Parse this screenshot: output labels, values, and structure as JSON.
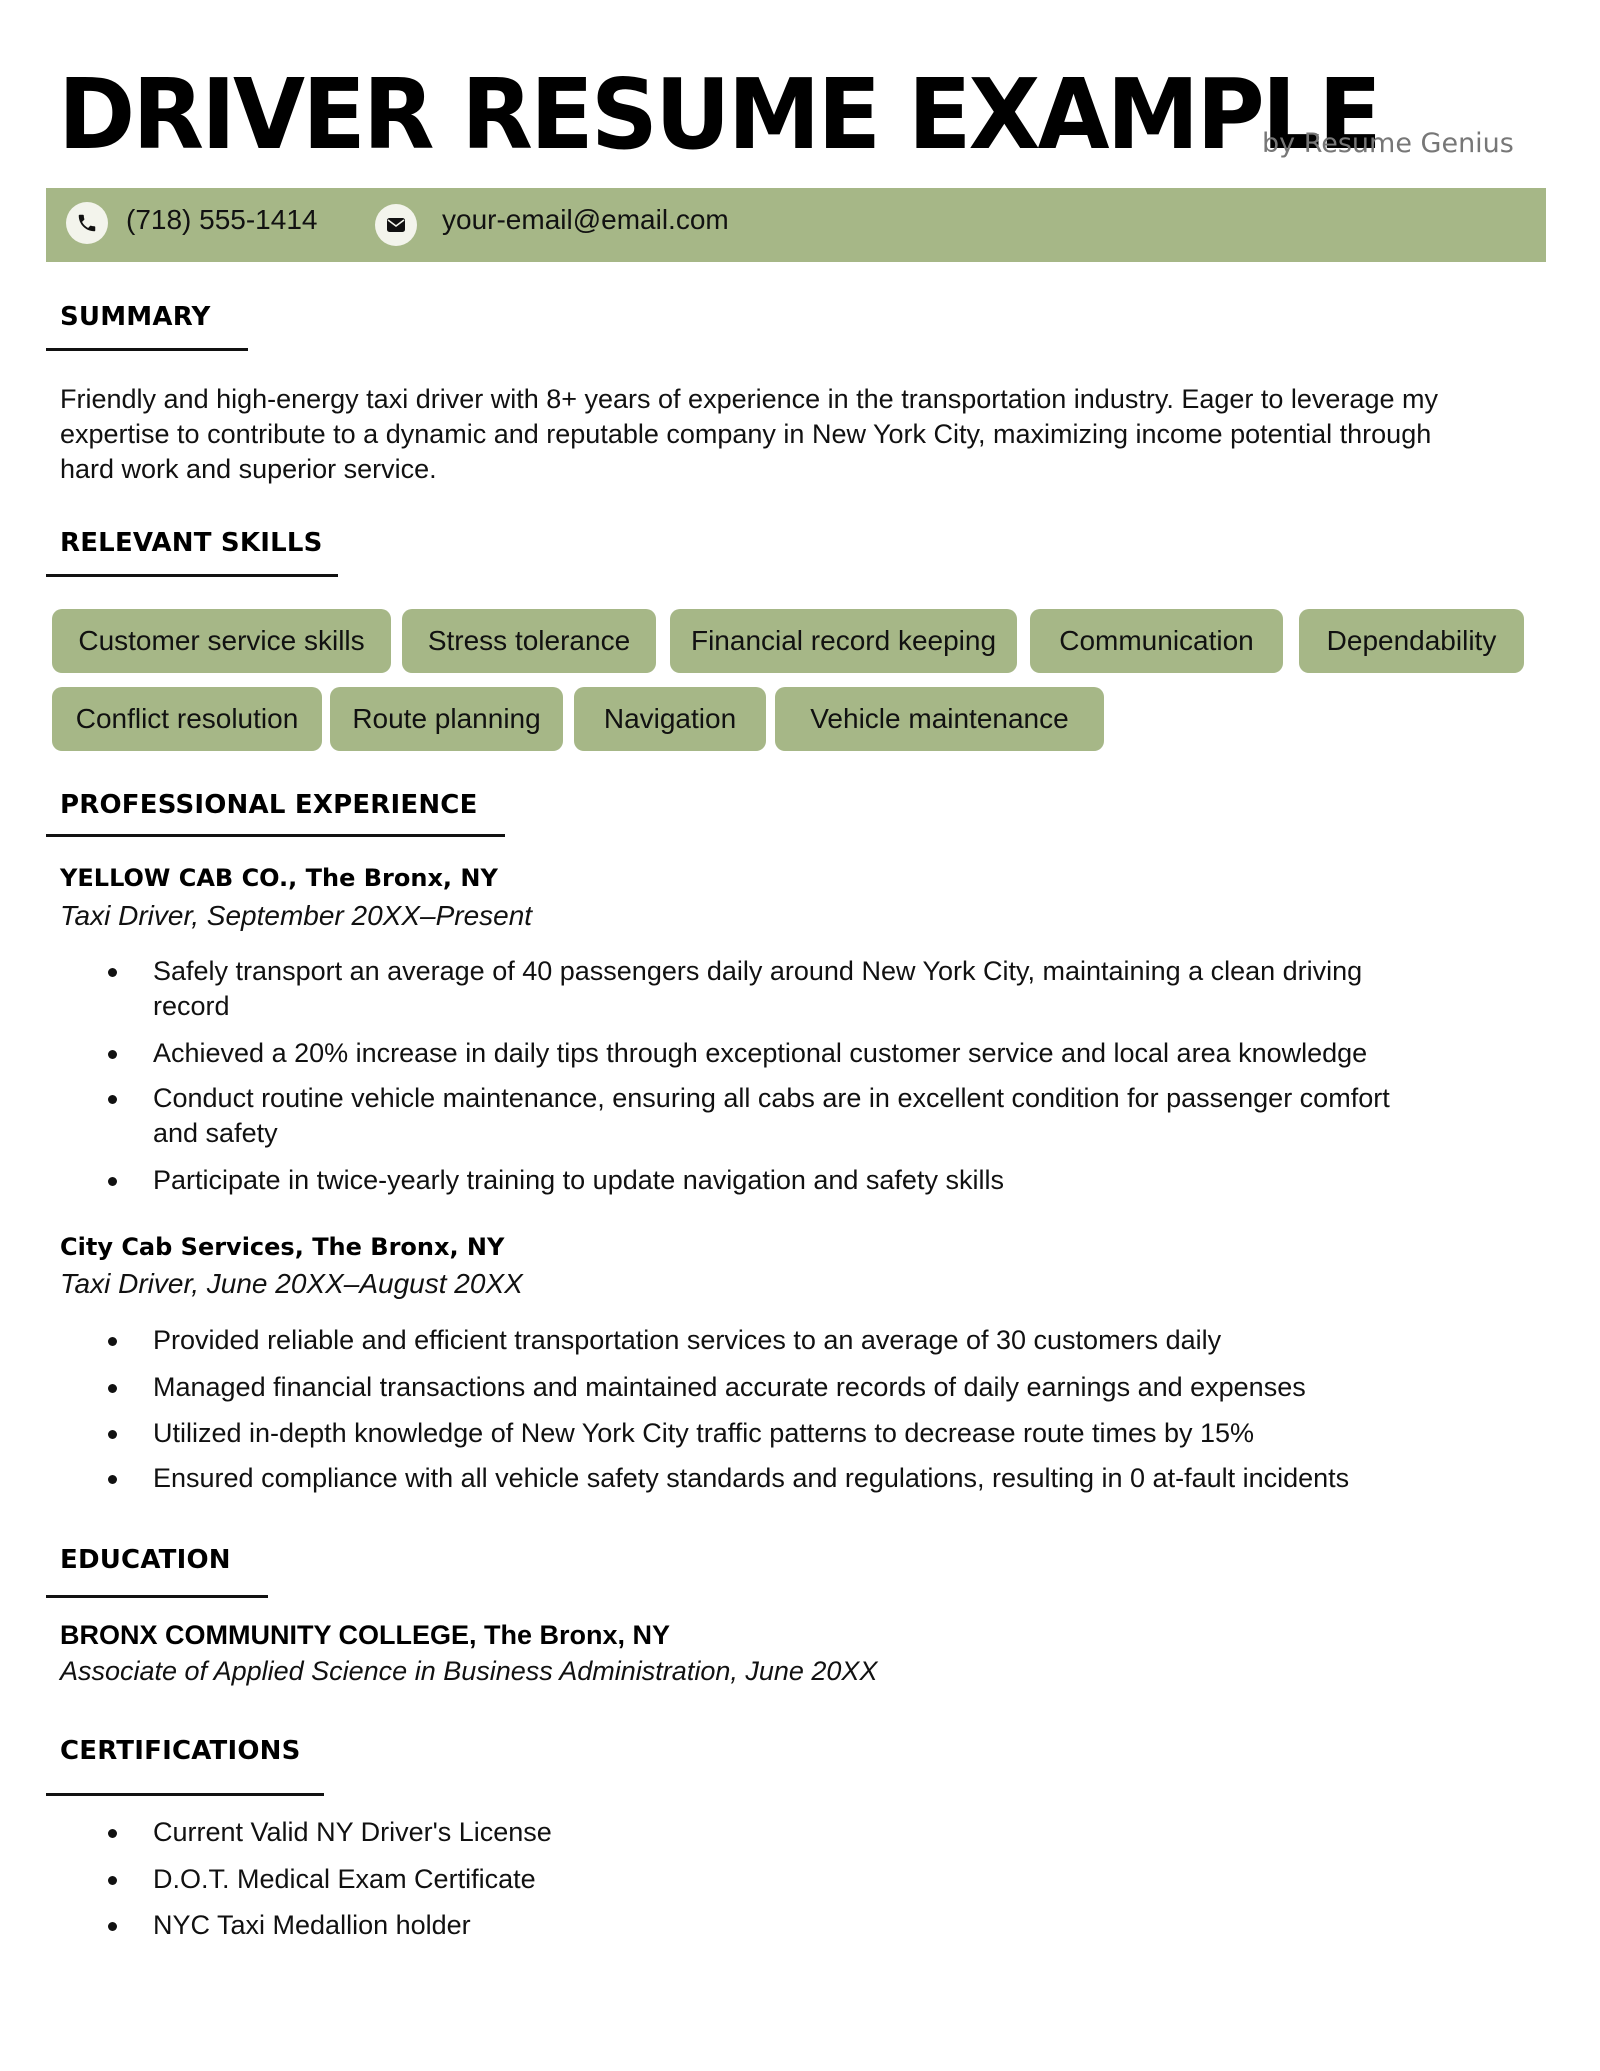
{
  "header": {
    "title": "DRIVER RESUME EXAMPLE",
    "byline": "by Resume Genius"
  },
  "contact": {
    "phone_icon": "phone-icon",
    "phone": "(718) 555-1414",
    "email_icon": "envelope-icon",
    "email": "your-email@email.com",
    "bar_color": "#a6b787"
  },
  "summary": {
    "heading": "SUMMARY",
    "lines": [
      "Friendly and high-energy taxi driver with 8+ years of experience in the transportation industry. Eager to leverage my",
      "expertise to contribute to a dynamic and reputable company in New York City, maximizing income potential through",
      "hard work and superior service."
    ]
  },
  "skills": {
    "heading": "RELEVANT SKILLS",
    "tag_color": "#a6b787",
    "items": [
      "Customer service skills",
      "Stress tolerance",
      "Financial record keeping",
      "Communication",
      "Dependability",
      "Conflict resolution",
      "Route planning",
      "Navigation",
      "Vehicle maintenance"
    ]
  },
  "experience": {
    "heading": "PROFESSIONAL EXPERIENCE",
    "jobs": [
      {
        "company": "YELLOW CAB CO., The Bronx, NY",
        "role": "Taxi Driver, September 20XX–Present",
        "bullets": [
          [
            "Safely transport an average of 40 passengers daily around New York City, maintaining a clean driving",
            "record"
          ],
          [
            "Achieved a 20% increase in daily tips through exceptional customer service and local area knowledge"
          ],
          [
            "Conduct routine vehicle maintenance, ensuring all cabs are in excellent condition for passenger comfort",
            "and safety"
          ],
          [
            "Participate in twice-yearly training to update navigation and safety skills"
          ]
        ]
      },
      {
        "company": "City Cab Services, The Bronx, NY",
        "role": "Taxi Driver, June 20XX–August 20XX",
        "bullets": [
          [
            "Provided reliable and efficient transportation services to an average of 30 customers daily"
          ],
          [
            "Managed financial transactions and maintained accurate records of daily earnings and expenses"
          ],
          [
            "Utilized in-depth knowledge of New York City traffic patterns to decrease route times by 15%"
          ],
          [
            "Ensured compliance with all vehicle safety standards and regulations, resulting in 0 at-fault incidents"
          ]
        ]
      }
    ]
  },
  "education": {
    "heading": "EDUCATION",
    "school": "BRONX COMMUNITY COLLEGE, The Bronx, NY",
    "degree": "Associate of Applied Science in Business Administration, June 20XX"
  },
  "certifications": {
    "heading": "CERTIFICATIONS",
    "items": [
      "Current Valid NY Driver's License",
      "D.O.T. Medical Exam Certificate",
      "NYC Taxi Medallion holder"
    ]
  }
}
